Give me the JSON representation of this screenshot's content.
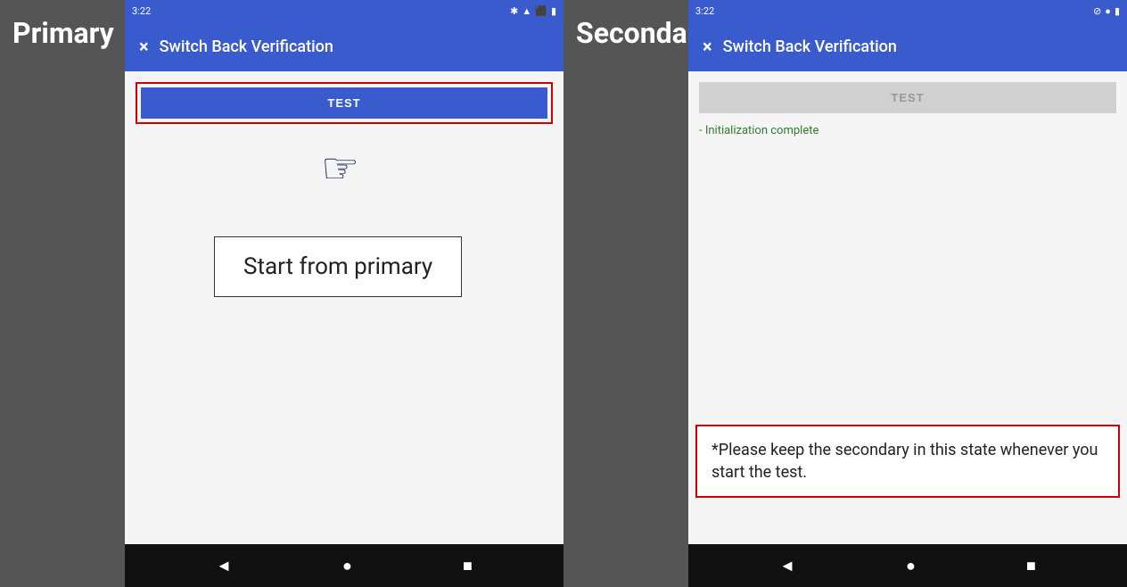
{
  "primary": {
    "panel_label": "Primary",
    "status_bar": {
      "time": "3:22",
      "icons_left": "⊙ ⊡ ⊞ ⊟ ●",
      "icons_right": "* ▲ ⬛ ▮"
    },
    "app_bar": {
      "close_icon": "×",
      "title": "Switch Back Verification"
    },
    "test_button_label": "TEST",
    "start_text": "Start from primary",
    "nav_back": "◄",
    "nav_home": "●",
    "nav_recents": "■"
  },
  "secondary": {
    "panel_label": "Secondary",
    "status_bar": {
      "time": "3:22",
      "icons_left": "⊙",
      "icons_right": "⊘ ● ▮"
    },
    "app_bar": {
      "close_icon": "×",
      "title": "Switch Back Verification"
    },
    "test_button_label": "TEST",
    "init_text": "- Initialization complete",
    "nav_back": "◄",
    "nav_home": "●",
    "nav_recents": "■",
    "note_text": "*Please keep the secondary in this state whenever you start the test."
  }
}
